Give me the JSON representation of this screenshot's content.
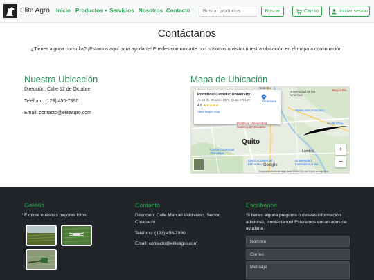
{
  "navbar": {
    "brand": "Elite Agro",
    "links": [
      "Inicio",
      "Productos",
      "Servicios",
      "Nosotros",
      "Contacto"
    ],
    "search_placeholder": "Buscar productos",
    "search_button": "Buscar",
    "cart_button": "Carrito",
    "login_button": "Iniciar sesión"
  },
  "contact": {
    "title": "Contáctanos",
    "intro": "¿Tienes alguna consulta? ¡Estamos aquí para ayudarte! Puedes comunicarte con nosotros o visitar nuestra ubicación en el mapa a continuación.",
    "location_heading": "Nuestra Ubicación",
    "address": "Dirección: Calle 12 de Octubre",
    "phone": "Teléfono: (123) 456-7890",
    "email": "Email: contacto@eliteagro.com",
    "map_heading": "Mapa de Ubicación"
  },
  "map": {
    "place_name": "Pontifical Catholic University ...",
    "place_address": "Av 12 de Octubre 1076, Quito 170143",
    "rating": "4.6",
    "stars": "★★★★★",
    "larger_map": "View larger map",
    "directions": "Directions",
    "city": "Quito",
    "labels": {
      "redentor": "Redentor",
      "udla": "Universidad de las Américas",
      "nayon": "Nayón Pa...",
      "paseo": "Paseo San Francisco",
      "puce": "Pontificia Universidad Católica del Ecuador",
      "scala": "Scala Shop...",
      "lumbisi": "Lumbisí",
      "ccr": "Centro Comercial El Recreo",
      "cca": "Centro Comercial Atahualpa",
      "usfq": "Universidad Internacional del..."
    },
    "zoom_in": "+",
    "zoom_out": "−",
    "google": "Google",
    "footer": "Keyboard shortcuts   Map data ©2024   Terms   Report a map error"
  },
  "footer": {
    "gallery_heading": "Galería",
    "gallery_text": "Explora nuestras mejores fotos.",
    "contact_heading": "Contacto",
    "contact_address": "Dirección: Calle Manuel Valdivieso, Sector Cotacachi",
    "contact_phone": "Teléfono: (123) 456-7890",
    "contact_email": "Email: contacto@eliteagro.com",
    "write_heading": "Escríbenos",
    "write_text": "Si tienes alguna pregunta o deseas información adicional, ¡contáctanos! Estaremos encantados de ayudarte.",
    "name_placeholder": "Nombre",
    "email_placeholder": "Correo",
    "message_placeholder": "Mensaje"
  },
  "colors": {
    "accent": "#2ea44f",
    "heading": "#2e8b57",
    "footer_bg": "#212529"
  }
}
